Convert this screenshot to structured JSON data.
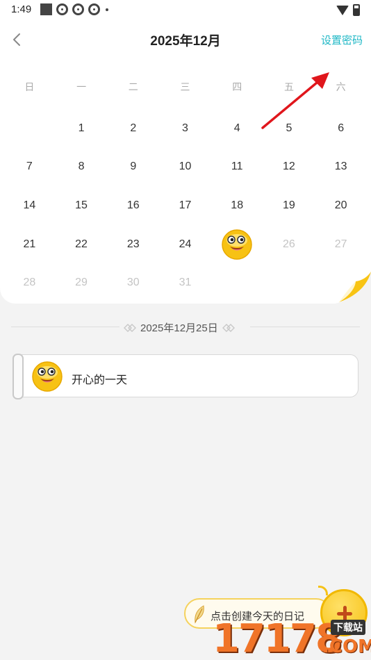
{
  "status_bar": {
    "time": "1:49"
  },
  "header": {
    "title": "2025年12月",
    "set_password_label": "设置密码"
  },
  "weekdays": [
    "日",
    "一",
    "二",
    "三",
    "四",
    "五",
    "六"
  ],
  "calendar": {
    "weeks": [
      [
        "",
        "1",
        "2",
        "3",
        "4",
        "5",
        "6"
      ],
      [
        "7",
        "8",
        "9",
        "10",
        "11",
        "12",
        "13"
      ],
      [
        "14",
        "15",
        "16",
        "17",
        "18",
        "19",
        "20"
      ],
      [
        "21",
        "22",
        "23",
        "24",
        "25",
        "26",
        "27"
      ],
      [
        "28",
        "29",
        "30",
        "31",
        "",
        "",
        ""
      ]
    ],
    "selected_day": "25",
    "selected_mood_icon": "happy-face-icon",
    "dim_after_day": 25
  },
  "selected_date": "2025年12月25日",
  "entry": {
    "mood_icon": "happy-face-icon",
    "text": "开心的一天"
  },
  "create": {
    "label": "点击创建今天的日记"
  },
  "watermark": {
    "number": "17178",
    "tag": "下载站",
    "suffix": ".COM"
  },
  "colors": {
    "accent": "#1fb8c6",
    "arrow": "#e0161c",
    "yellow": "#f7c214",
    "text_dim": "#c4c4c4"
  }
}
